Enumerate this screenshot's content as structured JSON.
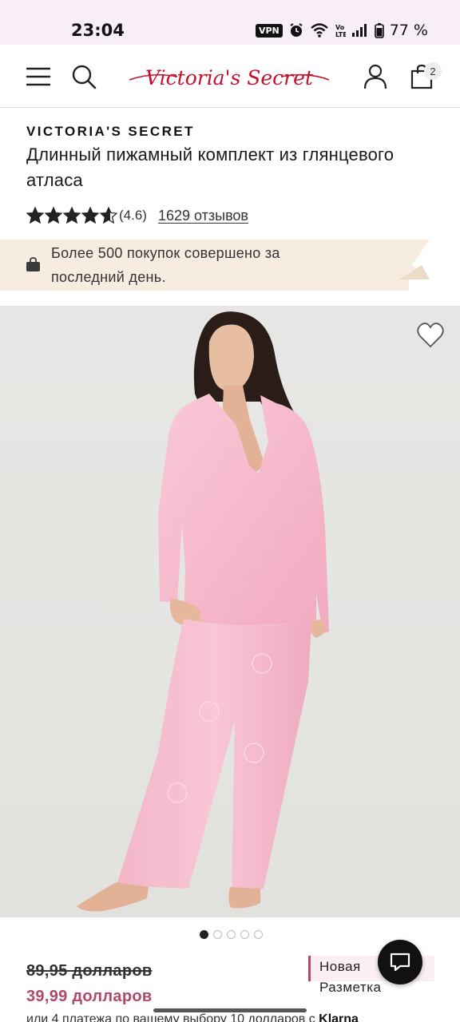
{
  "status_bar": {
    "time": "23:04",
    "vpn": "VPN",
    "battery": "77 %",
    "icons": [
      "vpn-icon",
      "alarm-icon",
      "wifi-icon",
      "volte-icon",
      "signal-icon",
      "battery-icon"
    ]
  },
  "header": {
    "logo_text": "Victoria's Secret",
    "bag_count": "2",
    "icons": [
      "menu-icon",
      "search-icon",
      "account-icon",
      "bag-icon"
    ],
    "accent_color": "#c8102e"
  },
  "product": {
    "brand": "VICTORIA'S SECRET",
    "title": "Длинный пижамный комплект из глянцевого атласа",
    "rating": 4.6,
    "rating_label": "(4.6)",
    "reviews_label": "1629 отзывов",
    "old_price": "89,95 долларов",
    "new_price": "39,99 долларов",
    "sale_color": "#b0486e"
  },
  "promo": {
    "text": "Более 500 покупок совершено за последний день.",
    "icon": "shopping-bag-icon"
  },
  "gallery": {
    "slides": 5,
    "active_index": 0,
    "wishlist_icon": "heart-icon"
  },
  "tag": {
    "line1": "Новая",
    "line2": "Разметка"
  },
  "chat": {
    "icon": "chat-icon"
  },
  "klarna": {
    "prefix": "или 4 платежа по вашему выбору 10 долларов с ",
    "brand": "Klarna"
  }
}
